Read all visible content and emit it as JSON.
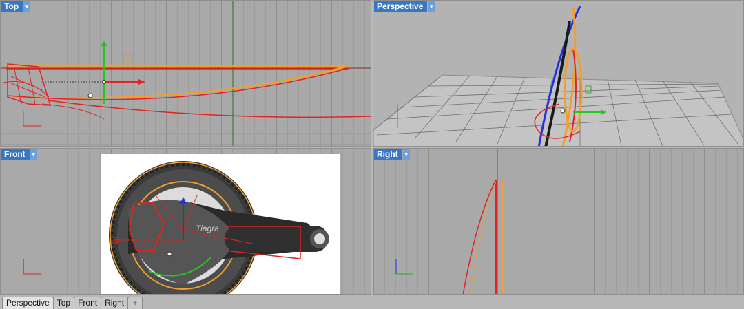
{
  "viewports": {
    "top": {
      "label": "Top"
    },
    "perspective": {
      "label": "Perspective"
    },
    "front": {
      "label": "Front"
    },
    "right": {
      "label": "Right"
    }
  },
  "tabs": [
    "Perspective",
    "Top",
    "Front",
    "Right"
  ],
  "add_tab_icon": "plus-icon",
  "dropdown_icon": "triangle-down-icon",
  "photo_logo_text": "Tiagra",
  "colors": {
    "title_bg": "#3a77c2",
    "curve_red": "#e02424",
    "curve_orange": "#f0a030",
    "gizmo_green": "#22c81a",
    "gizmo_blue": "#2233dd"
  }
}
